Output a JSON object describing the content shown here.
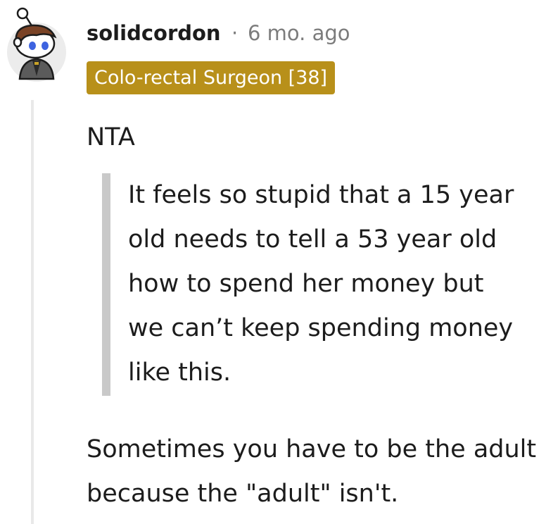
{
  "comment": {
    "avatar_icon": "snoo-avatar-icon",
    "username": "solidcordon",
    "separator": "·",
    "timestamp": "6 mo. ago",
    "flair": "Colo-rectal Surgeon [38]",
    "flair_color": "#b8901a",
    "body": {
      "paragraph_1": "NTA",
      "quote": "It feels so stupid that a 15 year old needs to tell a 53 year old how to spend her money but we can’t keep spending money like this.",
      "paragraph_2": "Sometimes you have to be the adult because the \"adult\" isn't."
    }
  }
}
